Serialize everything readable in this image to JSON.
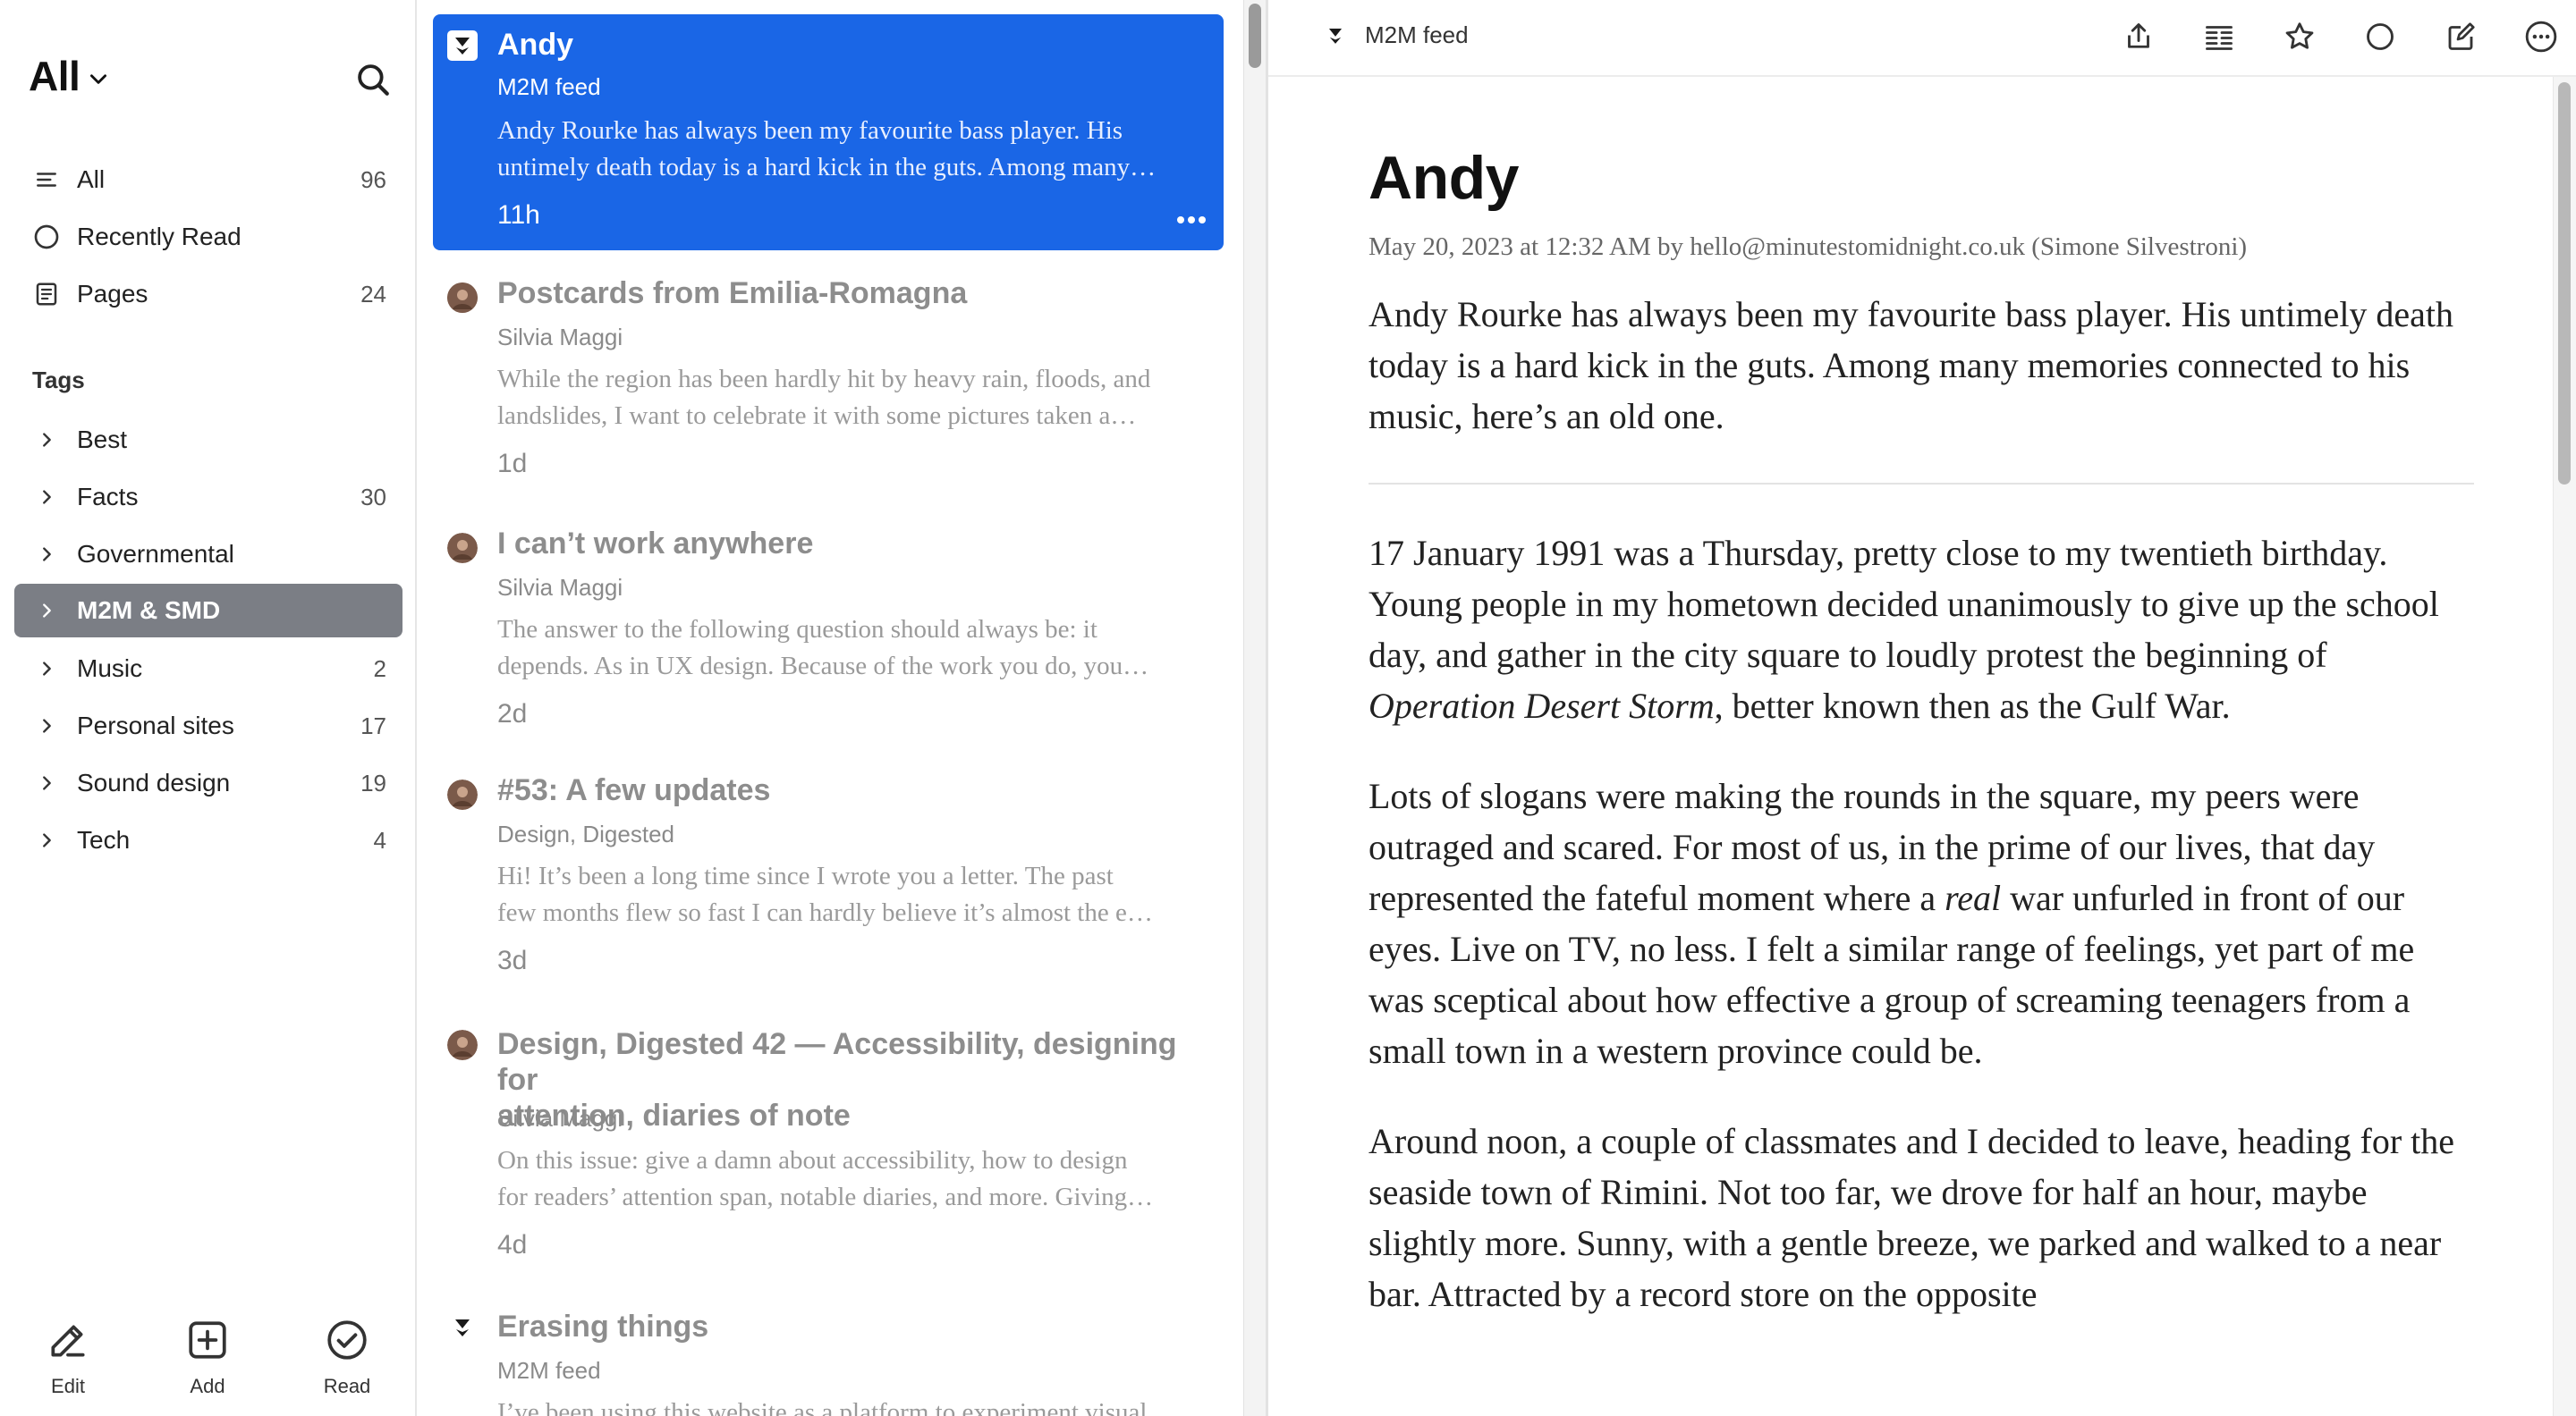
{
  "sidebar": {
    "title": "All",
    "smart": [
      {
        "label": "All",
        "count": "96",
        "icon": "list-icon"
      },
      {
        "label": "Recently Read",
        "count": "",
        "icon": "circle-icon"
      },
      {
        "label": "Pages",
        "count": "24",
        "icon": "page-icon"
      }
    ],
    "tags_heading": "Tags",
    "tags": [
      {
        "label": "Best",
        "count": ""
      },
      {
        "label": "Facts",
        "count": "30"
      },
      {
        "label": "Governmental",
        "count": ""
      },
      {
        "label": "M2M & SMD",
        "count": ""
      },
      {
        "label": "Music",
        "count": "2"
      },
      {
        "label": "Personal sites",
        "count": "17"
      },
      {
        "label": "Sound design",
        "count": "19"
      },
      {
        "label": "Tech",
        "count": "4"
      }
    ],
    "toolbar": {
      "edit": "Edit",
      "add": "Add",
      "read": "Read"
    }
  },
  "articles": [
    {
      "title": "Andy",
      "source": "M2M feed",
      "snippet1": "Andy Rourke has always been my favourite bass player. His",
      "snippet2": "untimely death today is a hard kick in the guts. Among many…",
      "age": "11h"
    },
    {
      "title": "Postcards from Emilia-Romagna",
      "source": "Silvia Maggi",
      "snippet1": "While the region has been hardly hit by heavy rain, floods, and",
      "snippet2": "landslides, I want to celebrate it with some pictures taken a…",
      "age": "1d"
    },
    {
      "title": "I can’t work anywhere",
      "source": "Silvia Maggi",
      "snippet1": "The answer to the following question should always be: it",
      "snippet2": "depends. As in UX design. Because of the work you do, you…",
      "age": "2d"
    },
    {
      "title": "#53: A few updates",
      "source": "Design, Digested",
      "snippet1": "Hi! It’s been a long time since I wrote you a letter. The past",
      "snippet2": "few months flew so fast I can hardly believe it’s almost the e…",
      "age": "3d"
    },
    {
      "title1": "Design, Digested 42 — Accessibility, designing for",
      "title2": "attention, diaries of note",
      "source": "Silvia Maggi",
      "snippet1": "On this issue: give a damn about accessibility, how to design",
      "snippet2": "for readers’ attention span, notable diaries, and more. Giving…",
      "age": "4d"
    },
    {
      "title": "Erasing things",
      "source": "M2M feed",
      "snippet1": "I’ve been using this website as a platform to experiment visual"
    }
  ],
  "reader": {
    "feed": "M2M feed",
    "title": "Andy",
    "meta": "May 20, 2023 at 12:32 AM by hello@minutestomidnight.co.uk (Simone Silvestroni)",
    "lede": "Andy Rourke has always been my favourite bass player. His untimely death today is a hard kick in the guts. Among many memories connected to his music, here’s an old one.",
    "p1_a": "17 January 1991 was a Thursday, pretty close to my twentieth birthday. Young people in my hometown decided unanimously to give up the school day, and gather in the city square to loudly protest the beginning of ",
    "p1_em": "Operation Desert Storm",
    "p1_b": ", better known then as the Gulf War.",
    "p2_a": "Lots of slogans were making the rounds in the square, my peers were outraged and scared. For most of us, in the prime of our lives, that day represented the fateful moment where a ",
    "p2_em": "real",
    "p2_b": " war unfurled in front of our eyes. Live on TV, no less. I felt a similar range of feelings, yet part of me was sceptical about how effective a group of screaming teenagers from a small town in a western province could be.",
    "p3": "Around noon, a couple of classmates and I decided to leave, heading for the seaside town of Rimini. Not too far, we drove for half an hour, maybe slightly more. Sunny, with a gentle breeze, we parked and walked to a near bar. Attracted by a record store on the opposite"
  },
  "colors": {
    "accent": "#1a66e6",
    "selected_tag": "#7b7e85"
  }
}
